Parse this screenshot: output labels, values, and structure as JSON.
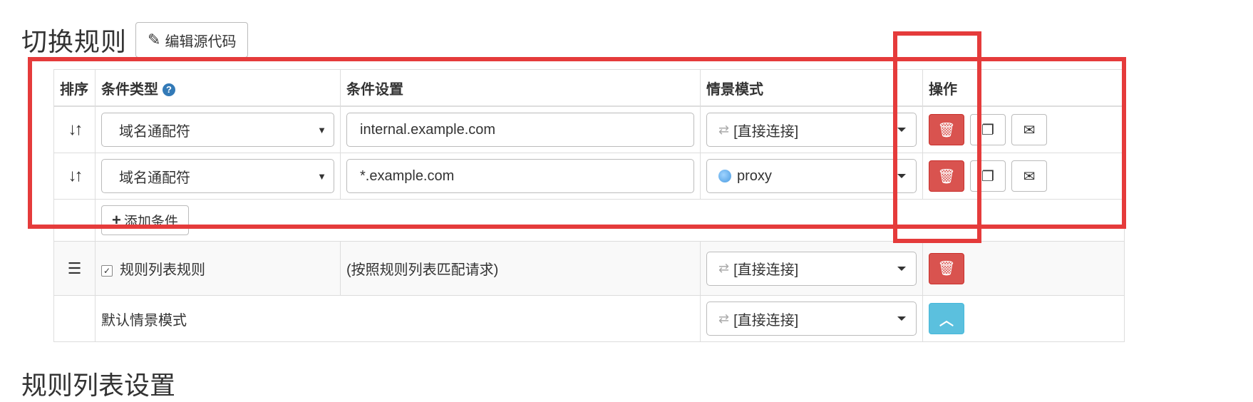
{
  "page": {
    "title": "切换规则",
    "edit_source_label": "编辑源代码",
    "next_section_title": "规则列表设置"
  },
  "table": {
    "headers": {
      "sort": "排序",
      "condition_type": "条件类型",
      "condition_value": "条件设置",
      "profile": "情景模式",
      "actions": "操作"
    },
    "help_icon": "?",
    "rules": [
      {
        "type": "域名通配符",
        "value": "internal.example.com",
        "profile": "[直接连接]",
        "profile_icon": "swap-icon"
      },
      {
        "type": "域名通配符",
        "value": "*.example.com",
        "profile": "proxy",
        "profile_icon": "globe-icon"
      }
    ],
    "add_condition_label": "添加条件",
    "rule_list": {
      "checked": true,
      "label": "规则列表规则",
      "description": "(按照规则列表匹配请求)",
      "profile": "[直接连接]"
    },
    "default": {
      "label": "默认情景模式",
      "profile": "[直接连接]"
    }
  },
  "colors": {
    "danger": "#d9534f",
    "info": "#5bc0de",
    "highlight": "#e53b3b",
    "help": "#337ab7"
  }
}
